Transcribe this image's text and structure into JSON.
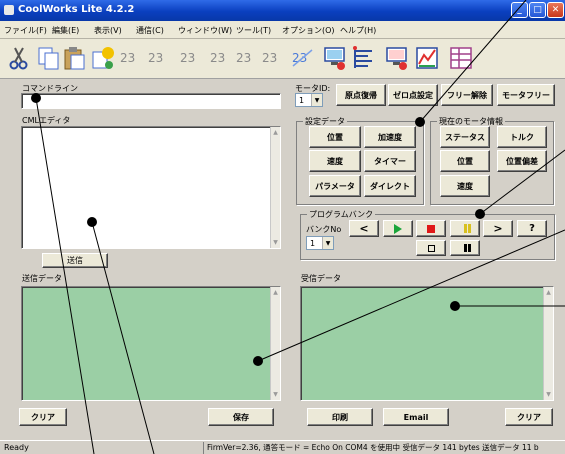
{
  "window": {
    "title": "CoolWorks Lite 4.2.2"
  },
  "menu": [
    "ファイル(F)",
    "編集(E)",
    "表示(V)",
    "通信(C)",
    "ウィンドウ(W)",
    "ツール(T)",
    "オプション(O)",
    "ヘルプ(H)"
  ],
  "toolbar_icons": [
    "cut-icon",
    "copy-icon",
    "paste-icon",
    "paste-special-icon",
    "send-a-icon",
    "send-b-icon",
    "send-c-icon",
    "send-d-icon",
    "send-e-icon",
    "send-f-icon",
    "send-g-icon",
    "monitor-icon",
    "list-icon",
    "monitor-chart-icon",
    "chart-icon",
    "table-icon"
  ],
  "command_line": {
    "label": "コマンドライン",
    "value": ""
  },
  "cml_editor": {
    "label": "CMLエディタ",
    "send_button": "送信"
  },
  "motor_id": {
    "label": "モータID:",
    "value": "1"
  },
  "top_buttons": [
    "原点復帰",
    "ゼロ点設定",
    "フリー解除",
    "モータフリー"
  ],
  "settings_data": {
    "label": "設定データ",
    "buttons": [
      "位置",
      "加速度",
      "速度",
      "タイマー",
      "パラメータ",
      "ダイレクト"
    ]
  },
  "motor_info": {
    "label": "現在のモータ情報",
    "buttons": [
      "ステータス",
      "トルク",
      "位置",
      "位置偏差",
      "速度"
    ]
  },
  "program_bank": {
    "label": "プログラムバンク",
    "bank_no_label": "バンクNo",
    "bank_no_value": "1",
    "controls": [
      "<",
      "play",
      "stop",
      "pause",
      ">",
      "?"
    ],
    "controls2": [
      "stop-square",
      "pause-bars"
    ]
  },
  "send_data": {
    "label": "送信データ"
  },
  "recv_data": {
    "label": "受信データ"
  },
  "bottom_buttons": {
    "clear_left": "クリア",
    "save": "保存",
    "print": "印刷",
    "email": "Email",
    "clear_right": "クリア"
  },
  "status": {
    "ready": "Ready",
    "info": "FirmVer=2.36, 通答モード = Echo On  COM4 を使用中  受信データ 141 bytes  送信データ 11 b"
  },
  "colors": {
    "green_panel": "#9bcfa5",
    "titlebar": "#0a3fbf",
    "play": "#1aa53a",
    "stop": "#e01818",
    "pause": "#d8c020"
  }
}
